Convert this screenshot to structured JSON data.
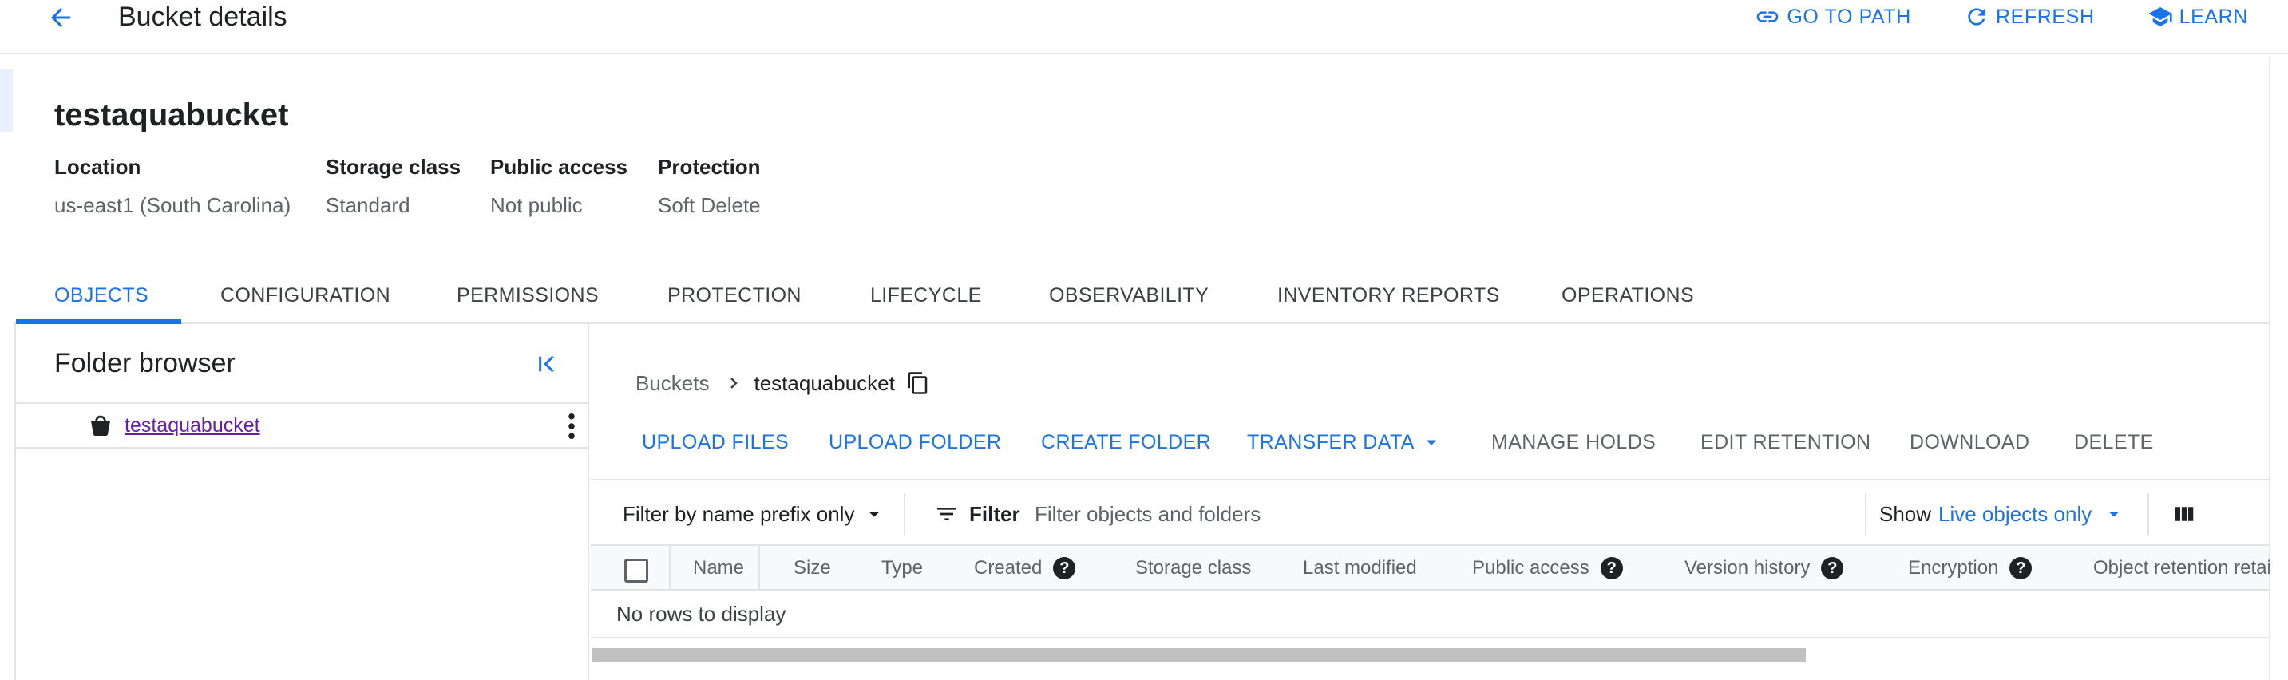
{
  "header": {
    "title": "Bucket details",
    "actions": [
      {
        "label": "GO TO PATH",
        "icon": "link-icon"
      },
      {
        "label": "REFRESH",
        "icon": "refresh-icon"
      },
      {
        "label": "LEARN",
        "icon": "school-icon"
      }
    ]
  },
  "bucket": {
    "name": "testaquabucket",
    "info": [
      {
        "label": "Location",
        "value": "us-east1 (South Carolina)"
      },
      {
        "label": "Storage class",
        "value": "Standard"
      },
      {
        "label": "Public access",
        "value": "Not public"
      },
      {
        "label": "Protection",
        "value": "Soft Delete"
      }
    ]
  },
  "tabs": [
    {
      "label": "OBJECTS",
      "active": true
    },
    {
      "label": "CONFIGURATION"
    },
    {
      "label": "PERMISSIONS"
    },
    {
      "label": "PROTECTION"
    },
    {
      "label": "LIFECYCLE"
    },
    {
      "label": "OBSERVABILITY"
    },
    {
      "label": "INVENTORY REPORTS"
    },
    {
      "label": "OPERATIONS"
    }
  ],
  "folder_browser": {
    "title": "Folder browser",
    "items": [
      {
        "label": "testaquabucket",
        "icon": "bucket-icon"
      }
    ]
  },
  "breadcrumb": {
    "root": "Buckets",
    "current": "testaquabucket"
  },
  "toolbar": {
    "primary": [
      "UPLOAD FILES",
      "UPLOAD FOLDER",
      "CREATE FOLDER",
      "TRANSFER DATA"
    ],
    "secondary": [
      "MANAGE HOLDS",
      "EDIT RETENTION",
      "DOWNLOAD",
      "DELETE"
    ]
  },
  "filter": {
    "prefix_select": "Filter by name prefix only",
    "label": "Filter",
    "placeholder": "Filter objects and folders",
    "show_label": "Show",
    "show_value": "Live objects only"
  },
  "table": {
    "columns": [
      {
        "label": "Name"
      },
      {
        "label": "Size"
      },
      {
        "label": "Type"
      },
      {
        "label": "Created",
        "help": true
      },
      {
        "label": "Storage class"
      },
      {
        "label": "Last modified"
      },
      {
        "label": "Public access",
        "help": true
      },
      {
        "label": "Version history",
        "help": true
      },
      {
        "label": "Encryption",
        "help": true
      },
      {
        "label": "Object retention retai"
      }
    ],
    "empty_text": "No rows to display",
    "help_glyph": "?"
  },
  "colors": {
    "accent": "#1a73e8",
    "link_visited": "#681da8",
    "text": "#202124",
    "muted": "#5f6368",
    "divider": "#e3e3e3"
  }
}
